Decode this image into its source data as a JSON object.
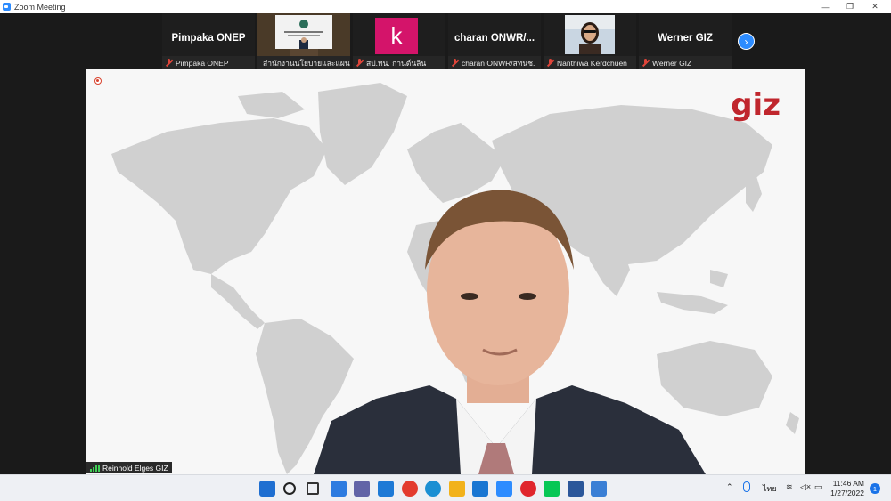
{
  "window": {
    "title": "Zoom Meeting",
    "controls": {
      "minimize": "—",
      "maximize": "❐",
      "close": "✕"
    }
  },
  "gallery": {
    "tiles": [
      {
        "display_name": "Pimpaka ONEP",
        "footer": "Pimpaka ONEP",
        "type": "name"
      },
      {
        "display_name": "",
        "footer": "สำนักงานนโยบายและแผนทรัพ...",
        "type": "video"
      },
      {
        "display_name": "k",
        "footer": "สป.ทน. กานต์นลิน",
        "type": "avatar",
        "avatar_color": "#d4146a"
      },
      {
        "display_name": "charan ONWR/...",
        "footer": "charan ONWR/สทนช.",
        "type": "name"
      },
      {
        "display_name": "",
        "footer": "Nanthiwa Kerdchuen",
        "type": "video"
      },
      {
        "display_name": "Werner GIZ",
        "footer": "Werner GIZ",
        "type": "name"
      }
    ],
    "next_page": "›"
  },
  "main_view": {
    "speaker_label": "Reinhold Elges GIZ",
    "logo_text": "giz",
    "logo_color": "#c0262d"
  },
  "taskbar": {
    "icons": [
      {
        "name": "start-icon",
        "color": "#1f6fd1"
      },
      {
        "name": "search-icon",
        "color": "#222222"
      },
      {
        "name": "task-view-icon",
        "color": "#333333"
      },
      {
        "name": "widgets-icon",
        "color": "#2d7be0"
      },
      {
        "name": "teams-chat-icon",
        "color": "#6264a7"
      },
      {
        "name": "mail-icon",
        "color": "#1e7ad6"
      },
      {
        "name": "chrome-icon",
        "color": "#e33b2e"
      },
      {
        "name": "edge-icon",
        "color": "#1b8fd3"
      },
      {
        "name": "file-explorer-icon",
        "color": "#f2b21b"
      },
      {
        "name": "l-app-icon",
        "color": "#1976d2"
      },
      {
        "name": "zoom-icon",
        "color": "#2d8cff"
      },
      {
        "name": "opera-icon",
        "color": "#e0262d"
      },
      {
        "name": "line-icon",
        "color": "#06c755"
      },
      {
        "name": "word-icon",
        "color": "#2b579a"
      },
      {
        "name": "snipping-tool-icon",
        "color": "#3a7fd5"
      }
    ],
    "tray": {
      "language": "ไทย",
      "time": "11:46 AM",
      "date": "1/27/2022",
      "notification_count": "1"
    }
  }
}
